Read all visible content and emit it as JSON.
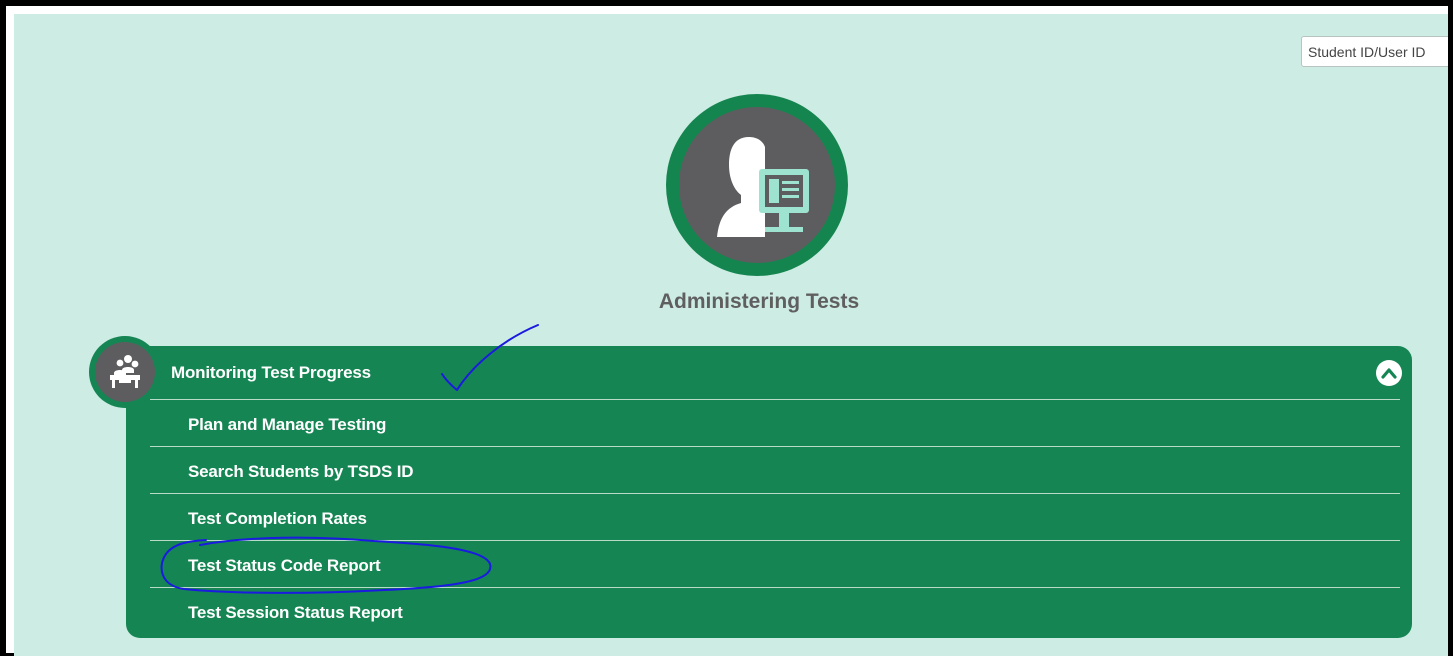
{
  "search": {
    "placeholder": "Student ID/User ID"
  },
  "hero": {
    "icon": "person-computer-icon"
  },
  "section": {
    "title": "Administering Tests"
  },
  "panel": {
    "title": "Monitoring Test Progress",
    "icon": "teacher-students-icon",
    "collapse_icon": "chevron-up-icon",
    "items": [
      {
        "label": "Plan and Manage Testing"
      },
      {
        "label": "Search Students by TSDS ID"
      },
      {
        "label": "Test Completion Rates"
      },
      {
        "label": "Test Status Code Report"
      },
      {
        "label": "Test Session Status Report"
      }
    ]
  },
  "annotations": {
    "checkmark_color": "#1a1ae0",
    "circle_color": "#1a1ae0"
  },
  "colors": {
    "background": "#cdece4",
    "brand_green": "#158553",
    "icon_gray": "#5d5d5f",
    "accent_mint": "#9de3cf"
  }
}
